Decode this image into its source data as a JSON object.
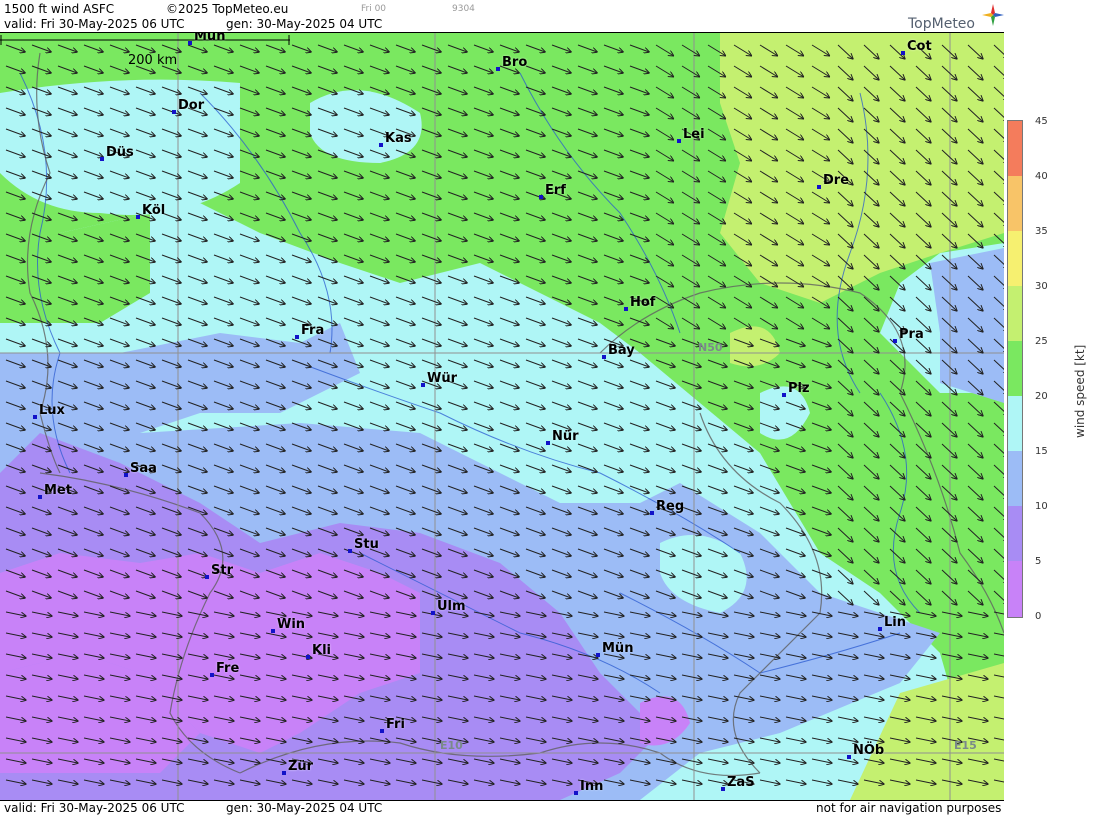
{
  "header": {
    "product": "1500 ft wind ASFC",
    "copyright": "©2025 TopMeteo.eu",
    "run_tag": "Fri 00",
    "code": "9304",
    "valid": "valid:  Fri  30-May-2025  06 UTC",
    "gen": "gen:  30-May-2025 04 UTC",
    "logo": "TopMeteo"
  },
  "footer": {
    "valid": "valid:  Fri  30-May-2025  06 UTC",
    "gen": "gen:  30-May-2025 04 UTC",
    "disclaimer": "not for air navigation purposes"
  },
  "scale": {
    "label": "200 km"
  },
  "grid_labels": {
    "n50": "N50",
    "e10": "E10",
    "e15": "E15"
  },
  "legend": {
    "title": "wind speed [kt]",
    "ticks": [
      "45",
      "40",
      "35",
      "30",
      "25",
      "20",
      "15",
      "10",
      "5",
      "0"
    ],
    "colors": {
      "0-5": "#c882f8",
      "5-10": "#a88cf4",
      "10-15": "#9cbcf6",
      "15-20": "#aff6f6",
      "20-25": "#7ae860",
      "25-30": "#c4f070",
      "30-35": "#f6f070",
      "35-40": "#f8c468",
      "40-45": "#f47c5c"
    }
  },
  "cities": [
    {
      "name": "Mün"
    },
    {
      "name": "Bro"
    },
    {
      "name": "Cot"
    },
    {
      "name": "Dor"
    },
    {
      "name": "Kas"
    },
    {
      "name": "Lei"
    },
    {
      "name": "Düs"
    },
    {
      "name": "Erf"
    },
    {
      "name": "Dre"
    },
    {
      "name": "Köl"
    },
    {
      "name": "Hof"
    },
    {
      "name": "Pra"
    },
    {
      "name": "Fra"
    },
    {
      "name": "Bay"
    },
    {
      "name": "Wür"
    },
    {
      "name": "Plz"
    },
    {
      "name": "Lux"
    },
    {
      "name": "Nür"
    },
    {
      "name": "Saa"
    },
    {
      "name": "Met"
    },
    {
      "name": "Reg"
    },
    {
      "name": "Stu"
    },
    {
      "name": "Str"
    },
    {
      "name": "Ulm"
    },
    {
      "name": "Lin"
    },
    {
      "name": "Win"
    },
    {
      "name": "Kli"
    },
    {
      "name": "Mün"
    },
    {
      "name": "Fre"
    },
    {
      "name": "Fri"
    },
    {
      "name": "NÖb"
    },
    {
      "name": "Zür"
    },
    {
      "name": "Inn"
    },
    {
      "name": "ZaS"
    }
  ]
}
